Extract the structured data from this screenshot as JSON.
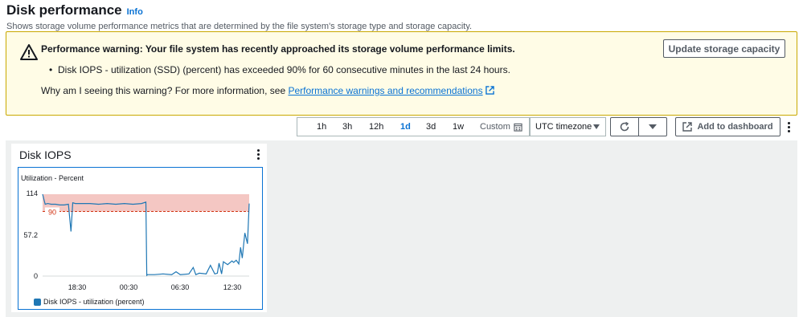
{
  "header": {
    "title": "Disk performance",
    "info_link": "Info",
    "subtitle": "Shows storage volume performance metrics that are determined by the file system's storage type and storage capacity."
  },
  "warning": {
    "icon": "warning-triangle-icon",
    "title": "Performance warning: Your file system has recently approached its storage volume performance limits.",
    "bullet": "Disk IOPS - utilization (SSD) (percent) has exceeded 90% for 60 consecutive minutes in the last 24 hours.",
    "why_text": "Why am I seeing this warning? For more information, see ",
    "link_text": "Performance warnings and recommendations",
    "button_label": "Update storage capacity"
  },
  "toolbar": {
    "time_ranges": [
      "1h",
      "3h",
      "12h",
      "1d",
      "3d",
      "1w"
    ],
    "active_range": "1d",
    "custom_label": "Custom",
    "timezone": "UTC timezone",
    "add_to_dashboard": "Add to dashboard"
  },
  "widget": {
    "title": "Disk IOPS",
    "colors": {
      "line": "#1f77b4",
      "threshold_band": "#f4c7c3",
      "threshold_line": "#d13212"
    }
  },
  "chart_data": {
    "type": "line",
    "title": "Disk IOPS",
    "ylabel": "Utilization - Percent",
    "ylim": [
      0,
      114
    ],
    "y_ticks": [
      "114",
      "57.2",
      "0"
    ],
    "x_ticks": [
      "18:30",
      "00:30",
      "06:30",
      "12:30"
    ],
    "threshold": {
      "value": 90,
      "label": "90"
    },
    "series": [
      {
        "name": "Disk IOPS - utilization (percent)",
        "x_hours": [
          0,
          0.3,
          0.6,
          1.0,
          1.5,
          2.0,
          2.5,
          3.0,
          3.3,
          3.5,
          3.8,
          4.5,
          5.5,
          6.5,
          7.5,
          8.5,
          9.5,
          10.5,
          11.5,
          12.0,
          12.1,
          12.2,
          13,
          14,
          15,
          15.5,
          16,
          17,
          17.5,
          17.8,
          18,
          18.2,
          19,
          19.5,
          20,
          20.3,
          20.5,
          20.8,
          21,
          21.5,
          22,
          22.2,
          22.5,
          22.8,
          23,
          23.2,
          23.5,
          23.8,
          24
        ],
        "values": [
          114,
          100,
          101,
          100,
          100,
          99,
          99,
          100,
          62,
          102,
          101,
          101,
          101,
          100,
          101,
          100,
          101,
          100,
          101,
          103,
          1,
          2,
          2,
          3,
          2,
          6,
          2,
          3,
          12,
          2,
          3,
          4,
          3,
          15,
          3,
          4,
          18,
          3,
          20,
          16,
          21,
          19,
          22,
          17,
          40,
          25,
          60,
          45,
          101
        ]
      }
    ]
  }
}
